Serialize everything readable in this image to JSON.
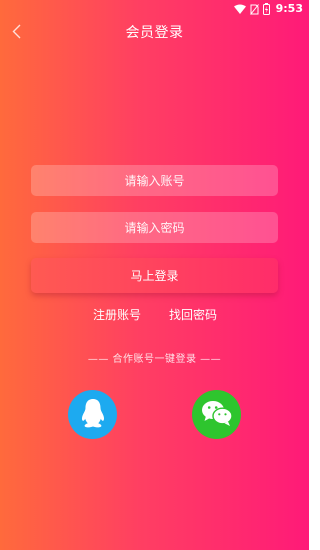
{
  "status_bar": {
    "time": "9:53",
    "icons": [
      "wifi-icon",
      "no-sim-icon",
      "battery-icon"
    ]
  },
  "header": {
    "back_icon": "chevron-left-icon",
    "title": "会员登录"
  },
  "form": {
    "account_placeholder": "请输入账号",
    "password_placeholder": "请输入密码",
    "login_label": "马上登录"
  },
  "links": {
    "register": "注册账号",
    "recover_password": "找回密码"
  },
  "third_party": {
    "divider_text": "—— 合作账号一键登录 ——",
    "providers": [
      {
        "name": "qq",
        "icon": "qq-penguin-icon",
        "color": "#1daaf0"
      },
      {
        "name": "wechat",
        "icon": "wechat-icon",
        "color": "#2ec52e"
      }
    ]
  },
  "colors": {
    "gradient_start": "#ff6a3c",
    "gradient_end": "#ff1a78"
  }
}
